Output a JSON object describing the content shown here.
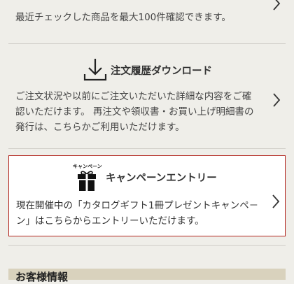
{
  "recent": {
    "description": "最近チェックした商品を最大100件確認できます。"
  },
  "order_download": {
    "title": "注文履歴ダウンロード",
    "icon": "download-icon",
    "description_line1": "ご注文状況や以前にご注文いただいた詳細な内容をご確",
    "description_line2": "認いただけます。 再注文や領収書・お買い上げ明細書の",
    "description_line3": "発行は、こちらかご利用いただけます。"
  },
  "campaign": {
    "title": "キャンペーンエントリー",
    "icon": "gift-icon",
    "icon_caption": "キャンペーン",
    "description_line1": "現在開催中の「カタログギフト1冊プレゼントキャンペ－",
    "description_line2": "ン」はこちらからエントリーいただけます。",
    "highlight_color": "#b3261e"
  },
  "next_section": {
    "title": "お客様情報"
  }
}
